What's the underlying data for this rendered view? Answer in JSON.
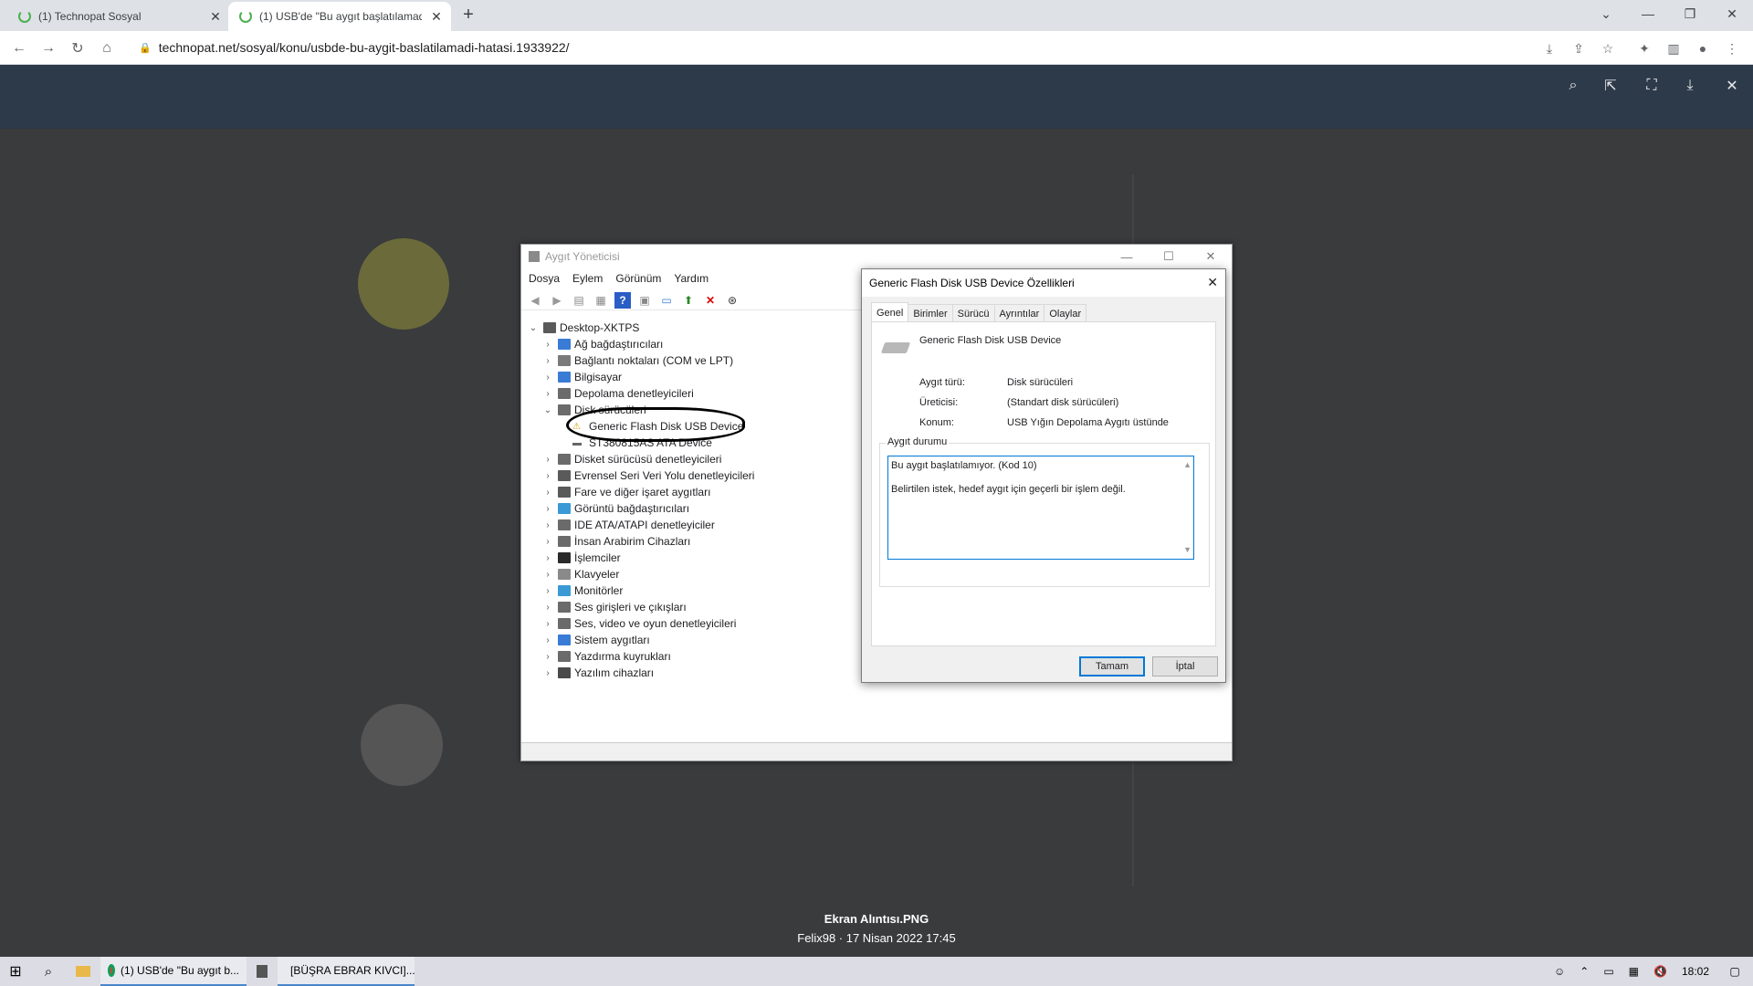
{
  "browser": {
    "tabs": [
      {
        "title": "(1) Technopat Sosyal",
        "active": false
      },
      {
        "title": "(1) USB'de \"Bu aygıt başlatılamad",
        "active": true
      }
    ],
    "url": "technopat.net/sosyal/konu/usbde-bu-aygit-baslatilamadi-hatasi.1933922/"
  },
  "lightbox": {
    "image_name": "Ekran Alıntısı.PNG",
    "meta": "Felix98 · 17 Nisan 2022 17:45"
  },
  "device_manager": {
    "title": "Aygıt Yöneticisi",
    "menu": [
      "Dosya",
      "Eylem",
      "Görünüm",
      "Yardım"
    ],
    "root": "Desktop-XKTPS",
    "nodes": [
      {
        "label": "Ağ bağdaştırıcıları",
        "color": "#3a7bd5"
      },
      {
        "label": "Bağlantı noktaları (COM ve LPT)",
        "color": "#7a7a7a"
      },
      {
        "label": "Bilgisayar",
        "color": "#3a7bd5"
      },
      {
        "label": "Depolama denetleyicileri",
        "color": "#6b6b6b"
      },
      {
        "label": "Disk sürücüleri",
        "color": "#6b6b6b",
        "expanded": true
      },
      {
        "label": "Disket sürücüsü denetleyicileri",
        "color": "#6b6b6b"
      },
      {
        "label": "Evrensel Seri Veri Yolu denetleyicileri",
        "color": "#5a5a5a"
      },
      {
        "label": "Fare ve diğer işaret aygıtları",
        "color": "#5a5a5a"
      },
      {
        "label": "Görüntü bağdaştırıcıları",
        "color": "#3a9ad5"
      },
      {
        "label": "IDE ATA/ATAPI denetleyiciler",
        "color": "#6b6b6b"
      },
      {
        "label": "İnsan Arabirim Cihazları",
        "color": "#6b6b6b"
      },
      {
        "label": "İşlemciler",
        "color": "#2a2a2a"
      },
      {
        "label": "Klavyeler",
        "color": "#8a8a8a"
      },
      {
        "label": "Monitörler",
        "color": "#3a9ad5"
      },
      {
        "label": "Ses girişleri ve çıkışları",
        "color": "#6b6b6b"
      },
      {
        "label": "Ses, video ve oyun denetleyicileri",
        "color": "#6b6b6b"
      },
      {
        "label": "Sistem aygıtları",
        "color": "#3a7bd5"
      },
      {
        "label": "Yazdırma kuyrukları",
        "color": "#6b6b6b"
      },
      {
        "label": "Yazılım cihazları",
        "color": "#4a4a4a"
      }
    ],
    "disk_children": [
      "Generic Flash Disk USB Device",
      "ST380815AS ATA Device"
    ]
  },
  "properties": {
    "title": "Generic Flash Disk USB Device Özellikleri",
    "tabs": [
      "Genel",
      "Birimler",
      "Sürücü",
      "Ayrıntılar",
      "Olaylar"
    ],
    "device_name": "Generic Flash Disk USB Device",
    "fields": [
      {
        "label": "Aygıt türü:",
        "value": "Disk sürücüleri"
      },
      {
        "label": "Üreticisi:",
        "value": "(Standart disk sürücüleri)"
      },
      {
        "label": "Konum:",
        "value": "USB Yığın Depolama Aygıtı üstünde"
      }
    ],
    "status_legend": "Aygıt durumu",
    "status_line1": "Bu aygıt başlatılamıyor. (Kod 10)",
    "status_line2": "Belirtilen istek, hedef aygıt için geçerli bir işlem değil.",
    "ok_label": "Tamam",
    "cancel_label": "İptal"
  },
  "taskbar": {
    "items": [
      "(1) USB'de \"Bu aygıt b...",
      "[BÜŞRA EBRAR KIVCI]..."
    ],
    "time": "18:02"
  }
}
